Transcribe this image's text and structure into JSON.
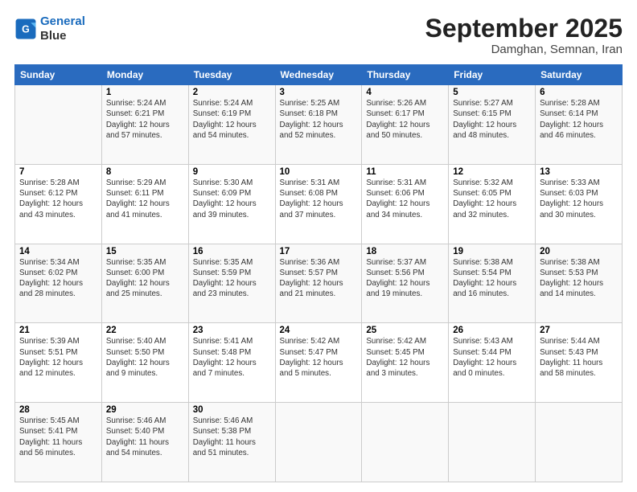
{
  "logo": {
    "line1": "General",
    "line2": "Blue"
  },
  "title": "September 2025",
  "subtitle": "Damghan, Semnan, Iran",
  "headers": [
    "Sunday",
    "Monday",
    "Tuesday",
    "Wednesday",
    "Thursday",
    "Friday",
    "Saturday"
  ],
  "weeks": [
    [
      {
        "day": "",
        "sunrise": "",
        "sunset": "",
        "daylight": ""
      },
      {
        "day": "1",
        "sunrise": "Sunrise: 5:24 AM",
        "sunset": "Sunset: 6:21 PM",
        "daylight": "Daylight: 12 hours and 57 minutes."
      },
      {
        "day": "2",
        "sunrise": "Sunrise: 5:24 AM",
        "sunset": "Sunset: 6:19 PM",
        "daylight": "Daylight: 12 hours and 54 minutes."
      },
      {
        "day": "3",
        "sunrise": "Sunrise: 5:25 AM",
        "sunset": "Sunset: 6:18 PM",
        "daylight": "Daylight: 12 hours and 52 minutes."
      },
      {
        "day": "4",
        "sunrise": "Sunrise: 5:26 AM",
        "sunset": "Sunset: 6:17 PM",
        "daylight": "Daylight: 12 hours and 50 minutes."
      },
      {
        "day": "5",
        "sunrise": "Sunrise: 5:27 AM",
        "sunset": "Sunset: 6:15 PM",
        "daylight": "Daylight: 12 hours and 48 minutes."
      },
      {
        "day": "6",
        "sunrise": "Sunrise: 5:28 AM",
        "sunset": "Sunset: 6:14 PM",
        "daylight": "Daylight: 12 hours and 46 minutes."
      }
    ],
    [
      {
        "day": "7",
        "sunrise": "Sunrise: 5:28 AM",
        "sunset": "Sunset: 6:12 PM",
        "daylight": "Daylight: 12 hours and 43 minutes."
      },
      {
        "day": "8",
        "sunrise": "Sunrise: 5:29 AM",
        "sunset": "Sunset: 6:11 PM",
        "daylight": "Daylight: 12 hours and 41 minutes."
      },
      {
        "day": "9",
        "sunrise": "Sunrise: 5:30 AM",
        "sunset": "Sunset: 6:09 PM",
        "daylight": "Daylight: 12 hours and 39 minutes."
      },
      {
        "day": "10",
        "sunrise": "Sunrise: 5:31 AM",
        "sunset": "Sunset: 6:08 PM",
        "daylight": "Daylight: 12 hours and 37 minutes."
      },
      {
        "day": "11",
        "sunrise": "Sunrise: 5:31 AM",
        "sunset": "Sunset: 6:06 PM",
        "daylight": "Daylight: 12 hours and 34 minutes."
      },
      {
        "day": "12",
        "sunrise": "Sunrise: 5:32 AM",
        "sunset": "Sunset: 6:05 PM",
        "daylight": "Daylight: 12 hours and 32 minutes."
      },
      {
        "day": "13",
        "sunrise": "Sunrise: 5:33 AM",
        "sunset": "Sunset: 6:03 PM",
        "daylight": "Daylight: 12 hours and 30 minutes."
      }
    ],
    [
      {
        "day": "14",
        "sunrise": "Sunrise: 5:34 AM",
        "sunset": "Sunset: 6:02 PM",
        "daylight": "Daylight: 12 hours and 28 minutes."
      },
      {
        "day": "15",
        "sunrise": "Sunrise: 5:35 AM",
        "sunset": "Sunset: 6:00 PM",
        "daylight": "Daylight: 12 hours and 25 minutes."
      },
      {
        "day": "16",
        "sunrise": "Sunrise: 5:35 AM",
        "sunset": "Sunset: 5:59 PM",
        "daylight": "Daylight: 12 hours and 23 minutes."
      },
      {
        "day": "17",
        "sunrise": "Sunrise: 5:36 AM",
        "sunset": "Sunset: 5:57 PM",
        "daylight": "Daylight: 12 hours and 21 minutes."
      },
      {
        "day": "18",
        "sunrise": "Sunrise: 5:37 AM",
        "sunset": "Sunset: 5:56 PM",
        "daylight": "Daylight: 12 hours and 19 minutes."
      },
      {
        "day": "19",
        "sunrise": "Sunrise: 5:38 AM",
        "sunset": "Sunset: 5:54 PM",
        "daylight": "Daylight: 12 hours and 16 minutes."
      },
      {
        "day": "20",
        "sunrise": "Sunrise: 5:38 AM",
        "sunset": "Sunset: 5:53 PM",
        "daylight": "Daylight: 12 hours and 14 minutes."
      }
    ],
    [
      {
        "day": "21",
        "sunrise": "Sunrise: 5:39 AM",
        "sunset": "Sunset: 5:51 PM",
        "daylight": "Daylight: 12 hours and 12 minutes."
      },
      {
        "day": "22",
        "sunrise": "Sunrise: 5:40 AM",
        "sunset": "Sunset: 5:50 PM",
        "daylight": "Daylight: 12 hours and 9 minutes."
      },
      {
        "day": "23",
        "sunrise": "Sunrise: 5:41 AM",
        "sunset": "Sunset: 5:48 PM",
        "daylight": "Daylight: 12 hours and 7 minutes."
      },
      {
        "day": "24",
        "sunrise": "Sunrise: 5:42 AM",
        "sunset": "Sunset: 5:47 PM",
        "daylight": "Daylight: 12 hours and 5 minutes."
      },
      {
        "day": "25",
        "sunrise": "Sunrise: 5:42 AM",
        "sunset": "Sunset: 5:45 PM",
        "daylight": "Daylight: 12 hours and 3 minutes."
      },
      {
        "day": "26",
        "sunrise": "Sunrise: 5:43 AM",
        "sunset": "Sunset: 5:44 PM",
        "daylight": "Daylight: 12 hours and 0 minutes."
      },
      {
        "day": "27",
        "sunrise": "Sunrise: 5:44 AM",
        "sunset": "Sunset: 5:43 PM",
        "daylight": "Daylight: 11 hours and 58 minutes."
      }
    ],
    [
      {
        "day": "28",
        "sunrise": "Sunrise: 5:45 AM",
        "sunset": "Sunset: 5:41 PM",
        "daylight": "Daylight: 11 hours and 56 minutes."
      },
      {
        "day": "29",
        "sunrise": "Sunrise: 5:46 AM",
        "sunset": "Sunset: 5:40 PM",
        "daylight": "Daylight: 11 hours and 54 minutes."
      },
      {
        "day": "30",
        "sunrise": "Sunrise: 5:46 AM",
        "sunset": "Sunset: 5:38 PM",
        "daylight": "Daylight: 11 hours and 51 minutes."
      },
      {
        "day": "",
        "sunrise": "",
        "sunset": "",
        "daylight": ""
      },
      {
        "day": "",
        "sunrise": "",
        "sunset": "",
        "daylight": ""
      },
      {
        "day": "",
        "sunrise": "",
        "sunset": "",
        "daylight": ""
      },
      {
        "day": "",
        "sunrise": "",
        "sunset": "",
        "daylight": ""
      }
    ]
  ]
}
